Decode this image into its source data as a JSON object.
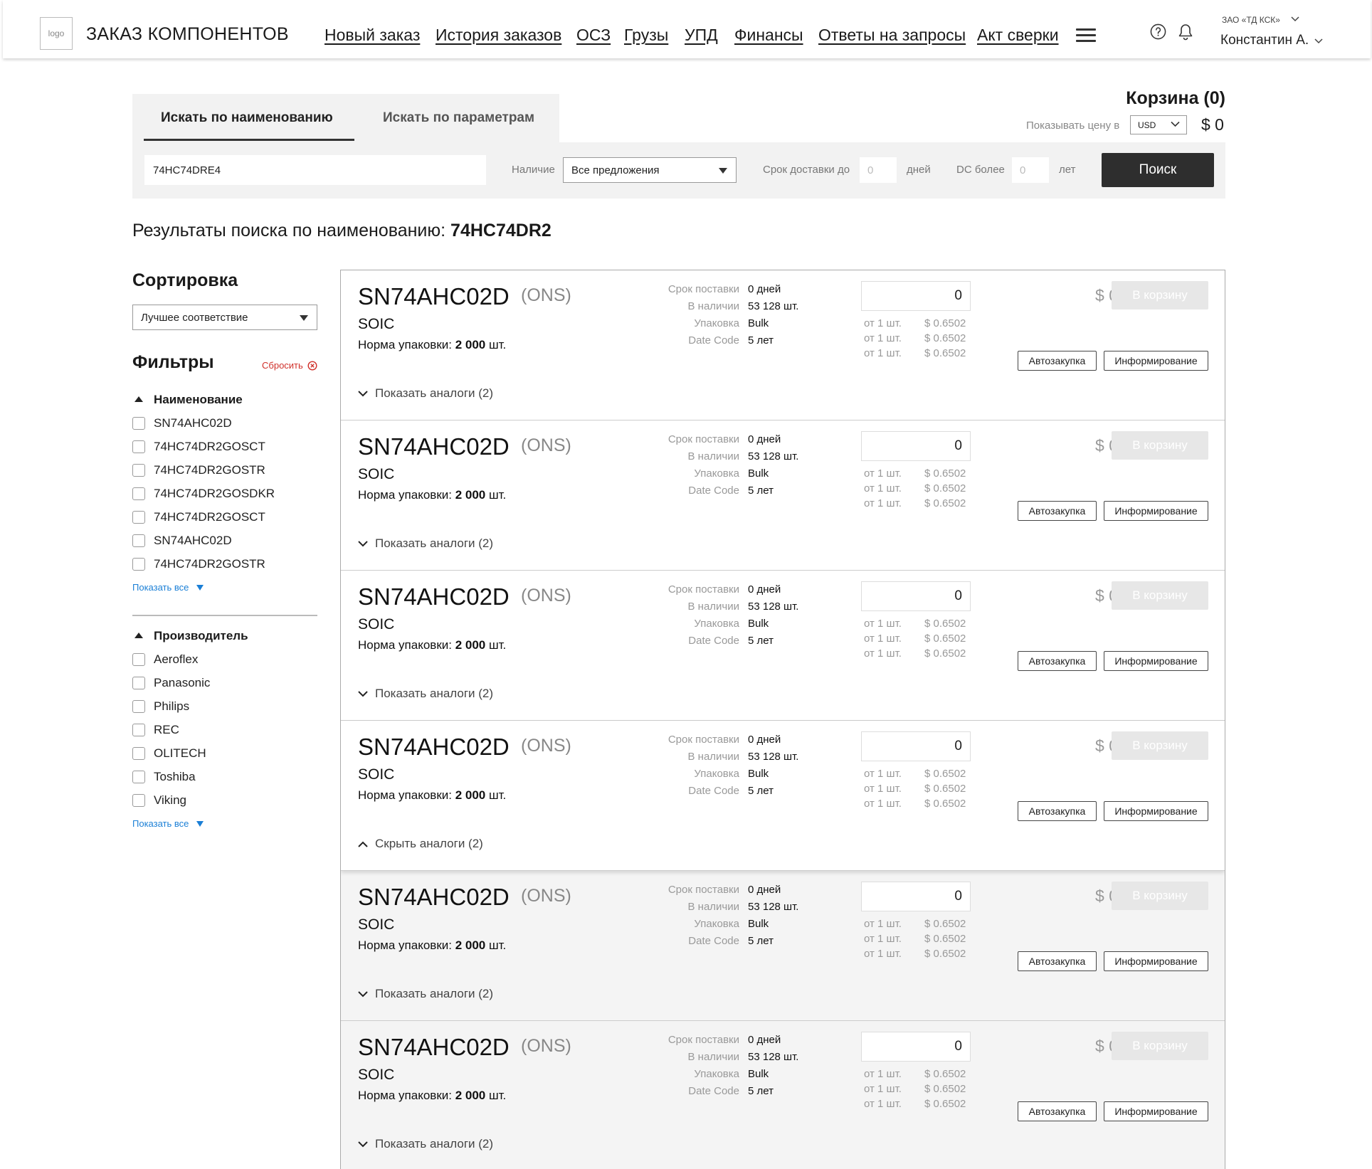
{
  "header": {
    "logo_text": "logo",
    "app_title": "ЗАКАЗ КОМПОНЕНТОВ",
    "nav": [
      "Новый заказ",
      "История заказов",
      "ОСЗ",
      "Грузы",
      "УПД",
      "Финансы",
      "Ответы на запросы",
      "Акт сверки"
    ],
    "company": "ЗАО «ТД КСК»",
    "user": "Константин А."
  },
  "search": {
    "tabs": [
      "Искать по наименованию",
      "Искать по параметрам"
    ],
    "query": "74HC74DRE4",
    "availability_label": "Наличие",
    "availability_value": "Все предложения",
    "delivery_label": "Срок доставки до",
    "delivery_placeholder": "0",
    "delivery_unit": "дней",
    "dc_label": "DC более",
    "dc_placeholder": "0",
    "dc_unit": "лет",
    "button": "Поиск"
  },
  "cart": {
    "title": "Корзина (0)",
    "price_label": "Показывать цену в",
    "currency": "USD",
    "total": "$ 0"
  },
  "results": {
    "prefix": "Результаты поиска по наименованию: ",
    "term": "74HC74DR2"
  },
  "sidebar": {
    "sort_title": "Сортировка",
    "sort_value": "Лучшее соответствие",
    "filters_title": "Фильтры",
    "reset": "Сбросить",
    "show_all": "Показать все",
    "name_facet": {
      "title": "Наименование",
      "items": [
        "SN74AHC02D",
        "74HC74DR2GOSCT",
        "74HC74DR2GOSTR",
        "74HC74DR2GOSDKR",
        "74HC74DR2GOSCT",
        "SN74AHC02D",
        "74HC74DR2GOSTR"
      ]
    },
    "mfr_facet": {
      "title": "Производитель",
      "items": [
        "Aeroflex",
        "Panasonic",
        "Philips",
        "REC",
        "OLITECH",
        "Toshiba",
        "Viking"
      ]
    }
  },
  "product_labels": {
    "lead_time": "Срок поставки",
    "stock": "В наличии",
    "packaging": "Упаковка",
    "date_code": "Date Code",
    "norm_prefix": "Норма упаковки: ",
    "norm_suffix": " шт.",
    "add_to_cart": "В корзину",
    "auto_purchase": "Автозакупка",
    "notify": "Информирование"
  },
  "products": [
    {
      "name": "SN74AHC02D",
      "manufacturer": "(ONS)",
      "package": "SOIC",
      "norm": "2 000",
      "lead_time": "0 дней",
      "stock": "53 128 шт.",
      "packaging": "Bulk",
      "date_code": "5 лет",
      "qty": "0",
      "line_total": "$ 0",
      "tiers": [
        {
          "from": "от 1 шт.",
          "price": "$ 0.6502"
        },
        {
          "from": "от 1 шт.",
          "price": "$ 0.6502"
        },
        {
          "from": "от 1 шт.",
          "price": "$ 0.6502"
        }
      ],
      "analogs": "Показать аналоги (2)",
      "analogs_open": false
    },
    {
      "name": "SN74AHC02D",
      "manufacturer": "(ONS)",
      "package": "SOIC",
      "norm": "2 000",
      "lead_time": "0 дней",
      "stock": "53 128 шт.",
      "packaging": "Bulk",
      "date_code": "5 лет",
      "qty": "0",
      "line_total": "$ 0",
      "tiers": [
        {
          "from": "от 1 шт.",
          "price": "$ 0.6502"
        },
        {
          "from": "от 1 шт.",
          "price": "$ 0.6502"
        },
        {
          "from": "от 1 шт.",
          "price": "$ 0.6502"
        }
      ],
      "analogs": "Показать аналоги (2)",
      "analogs_open": false
    },
    {
      "name": "SN74AHC02D",
      "manufacturer": "(ONS)",
      "package": "SOIC",
      "norm": "2 000",
      "lead_time": "0 дней",
      "stock": "53 128 шт.",
      "packaging": "Bulk",
      "date_code": "5 лет",
      "qty": "0",
      "line_total": "$ 0",
      "tiers": [
        {
          "from": "от 1 шт.",
          "price": "$ 0.6502"
        },
        {
          "from": "от 1 шт.",
          "price": "$ 0.6502"
        },
        {
          "from": "от 1 шт.",
          "price": "$ 0.6502"
        }
      ],
      "analogs": "Показать аналоги (2)",
      "analogs_open": false
    },
    {
      "name": "SN74AHC02D",
      "manufacturer": "(ONS)",
      "package": "SOIC",
      "norm": "2 000",
      "lead_time": "0 дней",
      "stock": "53 128 шт.",
      "packaging": "Bulk",
      "date_code": "5 лет",
      "qty": "0",
      "line_total": "$ 0",
      "tiers": [
        {
          "from": "от 1 шт.",
          "price": "$ 0.6502"
        },
        {
          "from": "от 1 шт.",
          "price": "$ 0.6502"
        },
        {
          "from": "от 1 шт.",
          "price": "$ 0.6502"
        }
      ],
      "analogs": "Скрыть аналоги (2)",
      "analogs_open": true
    },
    {
      "name": "SN74AHC02D",
      "manufacturer": "(ONS)",
      "package": "SOIC",
      "norm": "2 000",
      "lead_time": "0 дней",
      "stock": "53 128 шт.",
      "packaging": "Bulk",
      "date_code": "5 лет",
      "qty": "0",
      "line_total": "$ 0",
      "tiers": [
        {
          "from": "от 1 шт.",
          "price": "$ 0.6502"
        },
        {
          "from": "от 1 шт.",
          "price": "$ 0.6502"
        },
        {
          "from": "от 1 шт.",
          "price": "$ 0.6502"
        }
      ],
      "analogs": "Показать аналоги (2)",
      "analogs_open": false
    },
    {
      "name": "SN74AHC02D",
      "manufacturer": "(ONS)",
      "package": "SOIC",
      "norm": "2 000",
      "lead_time": "0 дней",
      "stock": "53 128 шт.",
      "packaging": "Bulk",
      "date_code": "5 лет",
      "qty": "0",
      "line_total": "$ 0",
      "tiers": [
        {
          "from": "от 1 шт.",
          "price": "$ 0.6502"
        },
        {
          "from": "от 1 шт.",
          "price": "$ 0.6502"
        },
        {
          "from": "от 1 шт.",
          "price": "$ 0.6502"
        }
      ],
      "analogs": "Показать аналоги (2)",
      "analogs_open": false
    }
  ],
  "colors": {
    "reset_red": "#d0302a",
    "link_blue": "#1a7fd6",
    "button_dark": "#2e2e2e",
    "panel_gray": "#f2f2f2"
  }
}
